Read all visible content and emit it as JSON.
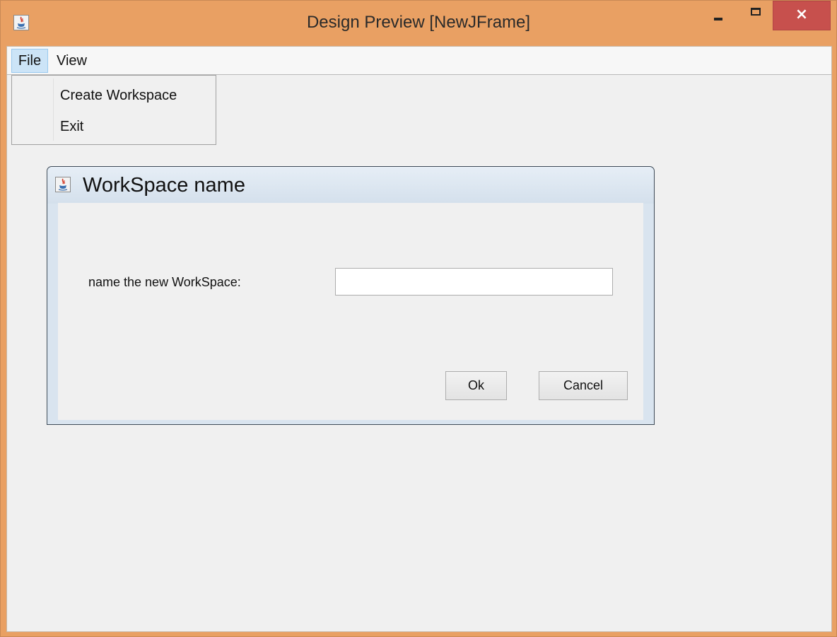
{
  "window": {
    "title": "Design Preview [NewJFrame]",
    "icon": "java-icon",
    "controls": {
      "minimize": "minimize-icon",
      "maximize": "maximize-icon",
      "close": "×"
    }
  },
  "menubar": {
    "items": [
      {
        "label": "File",
        "active": true
      },
      {
        "label": "View",
        "active": false
      }
    ]
  },
  "file_menu": {
    "items": [
      {
        "label": "Create Workspace"
      },
      {
        "label": "Exit"
      }
    ]
  },
  "dialog": {
    "title": "WorkSpace name",
    "icon": "java-icon",
    "field_label": "name the new WorkSpace:",
    "field_value": "",
    "ok_label": "Ok",
    "cancel_label": "Cancel"
  },
  "colors": {
    "frame_border": "#e9a063",
    "close_button": "#c7504d",
    "menu_highlight": "#cce4f7",
    "dialog_frame": "#d9e4ef"
  }
}
